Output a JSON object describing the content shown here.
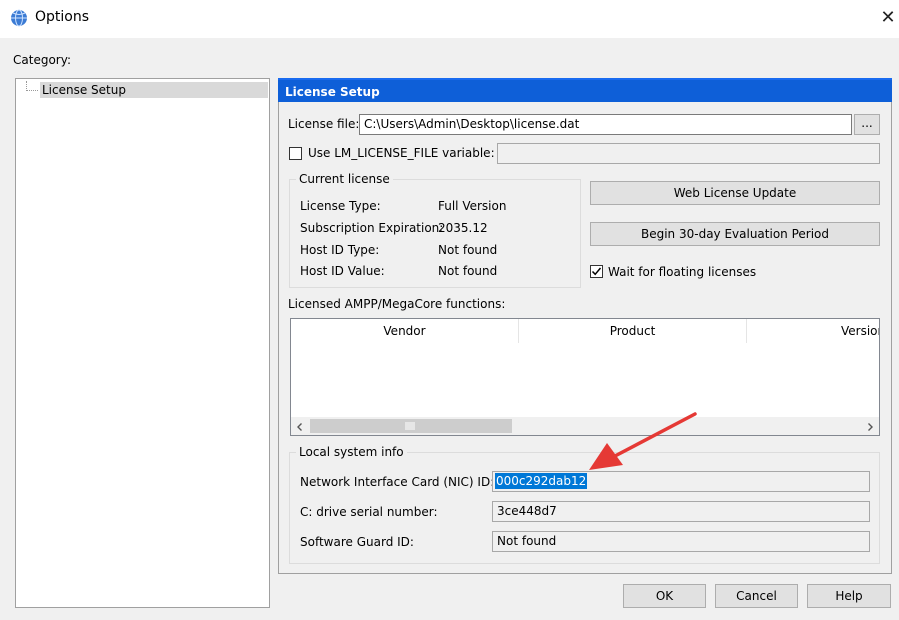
{
  "window": {
    "title": "Options",
    "close_glyph": "✕"
  },
  "category": {
    "label": "Category:",
    "items": [
      {
        "label": "License Setup"
      }
    ]
  },
  "panel": {
    "header": "License Setup",
    "license_file": {
      "label": "License file:",
      "value": "C:\\Users\\Admin\\Desktop\\license.dat",
      "browse_label": "..."
    },
    "lm_license": {
      "label": "Use LM_LICENSE_FILE variable:",
      "checked": false,
      "value": ""
    },
    "current_license": {
      "title": "Current license",
      "rows": [
        {
          "key": "License Type:",
          "value": "Full Version"
        },
        {
          "key": "Subscription Expiration:",
          "value": "2035.12"
        },
        {
          "key": "Host ID Type:",
          "value": "Not found"
        },
        {
          "key": "Host ID Value:",
          "value": "Not found"
        }
      ]
    },
    "web_license_update_label": "Web License Update",
    "evaluation_label": "Begin 30-day Evaluation Period",
    "wait_floating": {
      "label": "Wait for floating licenses",
      "checked": true
    },
    "licensed_functions": {
      "label": "Licensed AMPP/MegaCore functions:",
      "columns": [
        "Vendor",
        "Product",
        "Version"
      ]
    },
    "local_system": {
      "title": "Local system info",
      "nic": {
        "label": "Network Interface Card (NIC) ID:",
        "value": "000c292dab12"
      },
      "drive": {
        "label": "C: drive serial number:",
        "value": "3ce448d7"
      },
      "guard": {
        "label": "Software Guard ID:",
        "value": "Not found"
      }
    }
  },
  "footer": {
    "ok_label": "OK",
    "cancel_label": "Cancel",
    "help_label": "Help"
  },
  "colors": {
    "header_blue": "#0e5fd8",
    "selection_blue": "#0078d7",
    "annotation_red": "#e53935"
  }
}
